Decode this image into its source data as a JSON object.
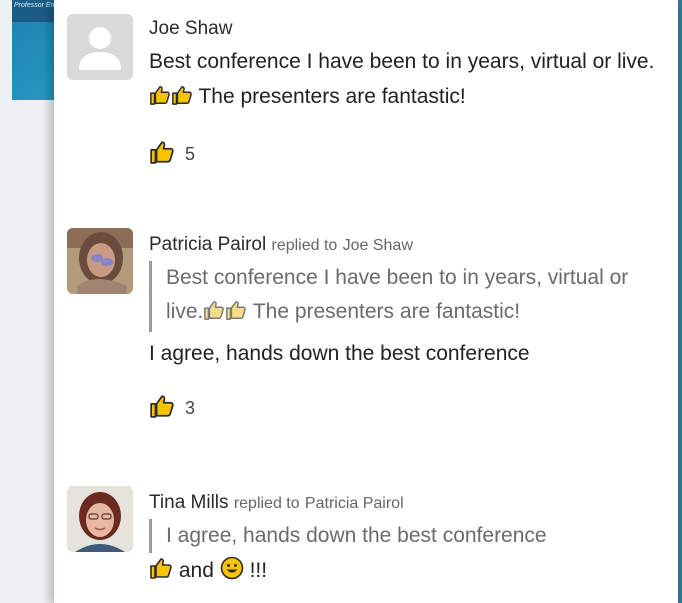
{
  "background": {
    "slide_caption": "Professor Emeritus, University of Maryland, Baltimore County"
  },
  "comments": [
    {
      "author": "Joe Shaw",
      "replied_to_prefix": "",
      "replied_to": "",
      "quote_a": "",
      "quote_b": "",
      "text_a": "Best conference I have been to in years, virtual or live.",
      "text_b": " The presenters are fantastic!",
      "likes": "5",
      "avatar": "placeholder-user-icon"
    },
    {
      "author": "Patricia Pairol",
      "replied_to_prefix": "replied to",
      "replied_to": "Joe Shaw",
      "quote_a": "Best conference I have been to in years, virtual or live.",
      "quote_b": " The presenters are fantastic!",
      "text": "I agree, hands down the best conference",
      "likes": "3",
      "avatar": "patricia-photo"
    },
    {
      "author": "Tina Mills",
      "replied_to_prefix": "replied to",
      "replied_to": "Patricia Pairol",
      "quote": "I agree, hands down the best conference",
      "text_and": "and",
      "text_end": "!!!",
      "avatar": "tina-photo"
    }
  ],
  "colors": {
    "thumb_fill": "#f7c400",
    "thumb_stroke": "#2b2b2b",
    "thumb_faded_fill": "#f3dd86",
    "smiley_fill": "#f7c400"
  }
}
